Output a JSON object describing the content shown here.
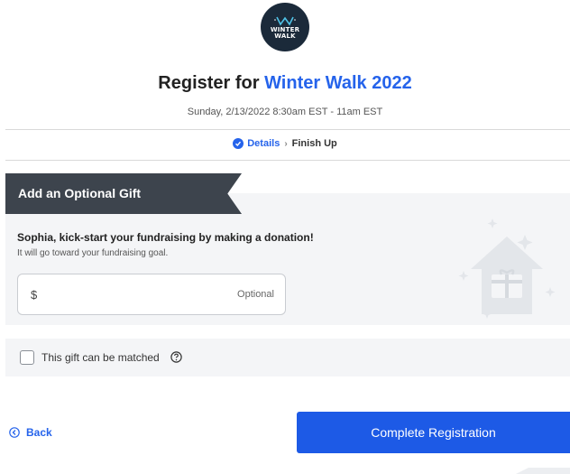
{
  "logo": {
    "line1": "WINTER",
    "line2": "WALK"
  },
  "header": {
    "title_prefix": "Register for ",
    "title_event": "Winter Walk 2022",
    "date_line": "Sunday, 2/13/2022 8:30am EST - 11am EST"
  },
  "steps": [
    {
      "label": "Details",
      "state": "done"
    },
    {
      "label": "Finish Up",
      "state": "current"
    }
  ],
  "gift": {
    "banner_title": "Add an Optional Gift",
    "heading": "Sophia, kick-start your fundraising by making a donation!",
    "subtext": "It will go toward your fundraising goal.",
    "amount": {
      "currency_symbol": "$",
      "value": "",
      "hint": "Optional"
    }
  },
  "match": {
    "label": "This gift can be matched",
    "checked": false
  },
  "footer": {
    "back_label": "Back",
    "complete_label": "Complete Registration"
  },
  "colors": {
    "accent": "#2563eb",
    "button": "#1d5ae6",
    "banner": "#3d444d",
    "panel": "#f4f5f7",
    "logo_bg": "#1b2a3a"
  },
  "icons": [
    "winter-walk-logo",
    "check-circle-icon",
    "chevron-right-icon",
    "gift-house-illustration",
    "help-circle-icon",
    "back-arrow-icon"
  ]
}
